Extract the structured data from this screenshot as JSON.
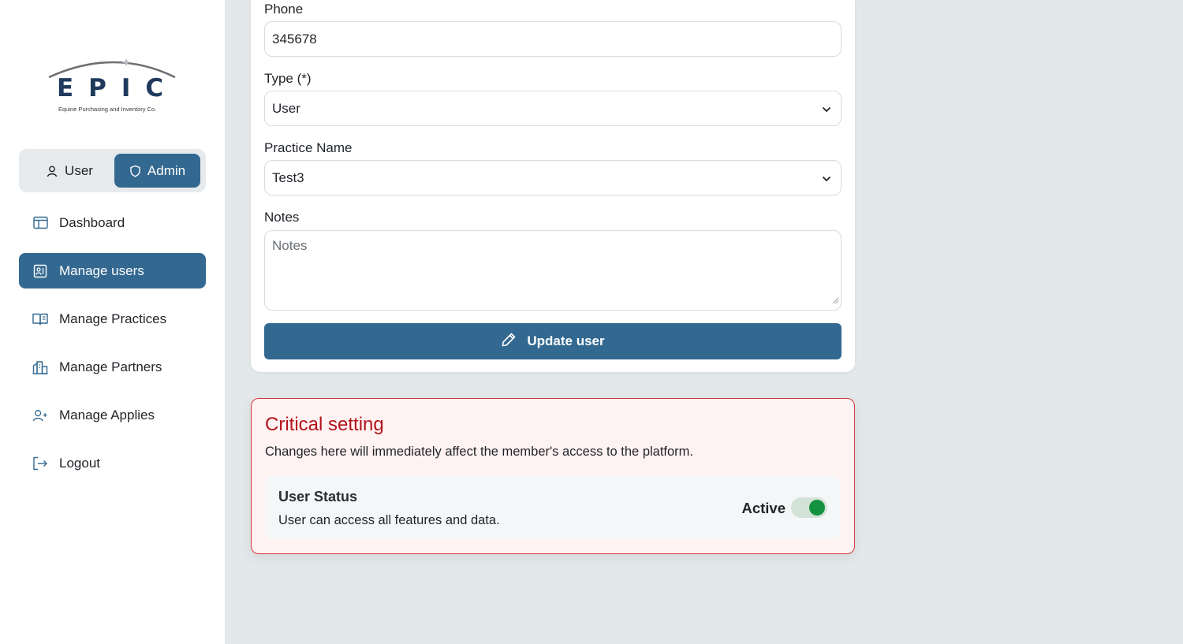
{
  "brand": {
    "letters": "EPIC",
    "tagline": "Equine Purchasing and Inventory Co."
  },
  "role_toggle": {
    "user_label": "User",
    "admin_label": "Admin",
    "selected": "Admin"
  },
  "sidebar": {
    "items": [
      {
        "label": "Dashboard",
        "icon": "layout-icon",
        "active": false
      },
      {
        "label": "Manage users",
        "icon": "contact-card-icon",
        "active": true
      },
      {
        "label": "Manage Practices",
        "icon": "open-book-icon",
        "active": false
      },
      {
        "label": "Manage Partners",
        "icon": "buildings-icon",
        "active": false
      },
      {
        "label": "Manage Applies",
        "icon": "user-plus-icon",
        "active": false
      },
      {
        "label": "Logout",
        "icon": "logout-icon",
        "active": false
      }
    ]
  },
  "form": {
    "phone": {
      "label": "Phone",
      "value": "345678"
    },
    "type": {
      "label": "Type (*)",
      "value": "User"
    },
    "practice": {
      "label": "Practice Name",
      "value": "Test3"
    },
    "notes": {
      "label": "Notes",
      "placeholder": "Notes",
      "value": ""
    },
    "submit_label": "Update user"
  },
  "critical": {
    "title": "Critical setting",
    "description": "Changes here will immediately affect the member's access to the platform.",
    "status_title": "User Status",
    "status_description": "User can access all features and data.",
    "status_value": "Active",
    "status_on": true
  },
  "colors": {
    "primary": "#336890",
    "page_bg": "#e3e8ea",
    "danger": "#b3141b",
    "danger_border": "#d7373d",
    "danger_bg": "#fff2f2",
    "toggle_on": "#14923f"
  }
}
